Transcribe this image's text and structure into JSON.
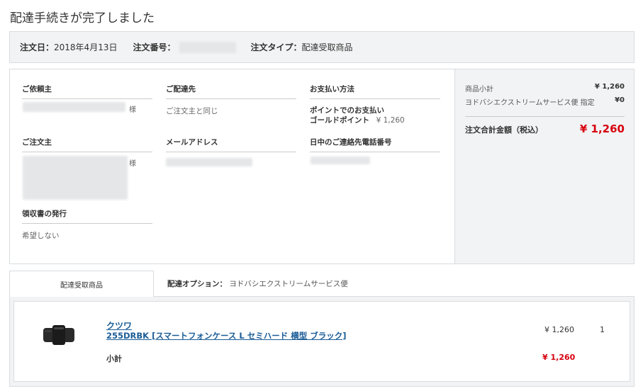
{
  "page": {
    "title": "配達手続きが完了しました"
  },
  "order_bar": {
    "date_label": "注文日：",
    "date_value": "2018年4月13日",
    "number_label": "注文番号：",
    "type_label": "注文タイプ：",
    "type_value": "配達受取商品"
  },
  "info": {
    "requester": {
      "heading": "ご依頼主",
      "suffix": "様"
    },
    "delivery": {
      "heading": "ご配達先",
      "value": "ご注文主と同じ"
    },
    "payment": {
      "heading": "お支払い方法",
      "method_line1": "ポイントでのお支払い",
      "method_line2": "ゴールドポイント",
      "amount": "¥ 1,260"
    },
    "orderer": {
      "heading": "ご注文主",
      "suffix": "様"
    },
    "email": {
      "heading": "メールアドレス"
    },
    "phone": {
      "heading": "日中のご連絡先電話番号"
    },
    "receipt": {
      "heading": "領収書の発行",
      "value": "希望しない"
    }
  },
  "summary": {
    "subtotal_label": "商品小計",
    "subtotal_value": "¥ 1,260",
    "shipping_label": "ヨドバシエクストリームサービス便 指定",
    "shipping_value": "¥0",
    "total_label": "注文合計金額（税込）",
    "total_value": "¥ 1,260"
  },
  "tabs": {
    "active_label": "配達受取商品",
    "option_label": "配達オプション：",
    "option_value": "ヨドバシエクストリームサービス便"
  },
  "item": {
    "brand": "クツワ",
    "name": "255DRBK [スマートフォンケース L セミハード 横型 ブラック]",
    "price": "¥ 1,260",
    "quantity": "1",
    "subtotal_label": "小計",
    "subtotal_value": "¥ 1,260"
  },
  "colors": {
    "accent_red": "#d7000f",
    "link_blue": "#1a5c96",
    "panel_gray": "#f2f3f4"
  }
}
